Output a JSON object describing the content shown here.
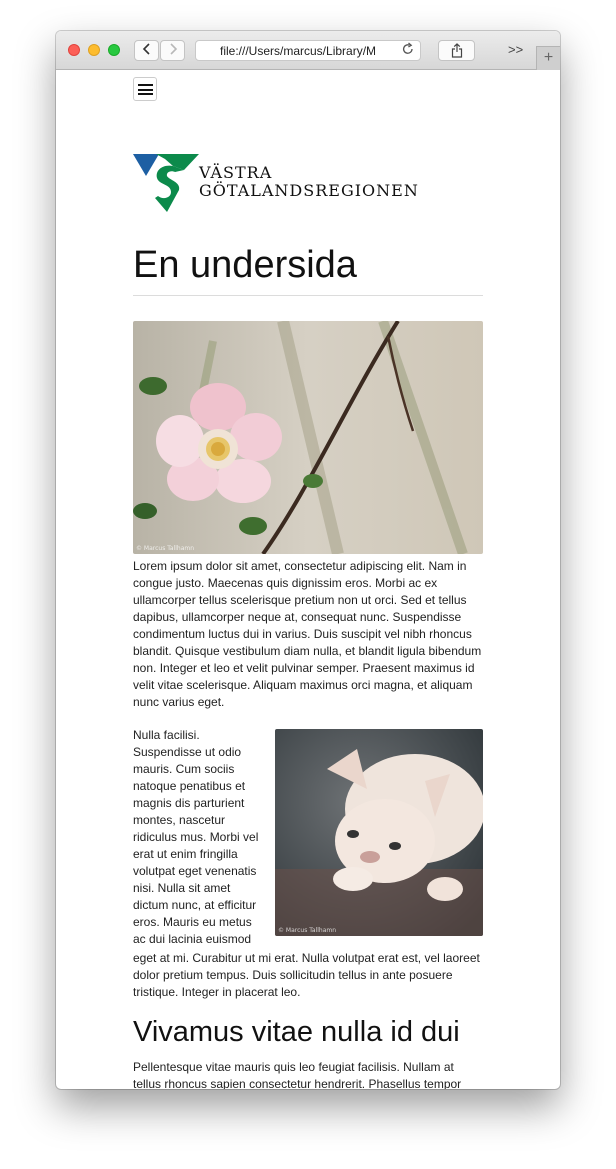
{
  "browser": {
    "url": "file:///Users/marcus/Library/M",
    "back_icon": "chevron-left-icon",
    "forward_icon": "chevron-right-icon",
    "reload_icon": "reload-icon",
    "share_icon": "share-icon",
    "overflow_label": ">>",
    "new_tab_label": "+"
  },
  "site": {
    "menu_icon": "hamburger-menu-icon",
    "logo": {
      "line1": "VÄSTRA",
      "line2": "GÖTALANDSREGIONEN",
      "colors": {
        "blue": "#1d5fa3",
        "green": "#0c8a4b"
      }
    }
  },
  "page": {
    "title": "En undersida",
    "image1": {
      "credit": "© Marcus Tallhamn"
    },
    "paragraph1": "Lorem ipsum dolor sit amet, consectetur adipiscing elit. Nam in congue justo. Maecenas quis dignissim eros. Morbi ac ex ullamcorper tellus scelerisque pretium non ut orci. Sed et tellus dapibus, ullamcorper neque at, consequat nunc. Suspendisse condimentum luctus dui in varius. Duis suscipit vel nibh rhoncus blandit. Quisque vestibulum diam nulla, et blandit ligula bibendum non. Integer et leo et velit pulvinar semper. Praesent maximus id velit vitae scelerisque. Aliquam maximus orci magna, et aliquam nunc varius eget.",
    "image2": {
      "credit": "© Marcus Tallhamn"
    },
    "paragraph2_float": "Nulla facilisi. Suspendisse ut odio mauris. Cum sociis natoque penatibus et magnis dis parturient montes, nascetur ridiculus mus. Morbi vel erat ut enim fringilla volutpat eget venenatis nisi. Nulla sit amet dictum nunc, at efficitur eros. Mauris eu metus ac dui lacinia euismod",
    "paragraph2_rest": "eget at mi. Curabitur ut mi erat. Nulla volutpat erat est, vel laoreet dolor pretium tempus. Duis sollicitudin tellus in ante posuere tristique. Integer in placerat leo.",
    "section_heading": "Vivamus vitae nulla id dui",
    "paragraph3": "Pellentesque vitae mauris quis leo feugiat facilisis. Nullam at tellus rhoncus sapien consectetur hendrerit. Phasellus tempor justo semper, pharetra urna ut, egestas quam. Interdum et malesuada fames ac ante ipsum primis in faucibus. Suspendisse"
  }
}
